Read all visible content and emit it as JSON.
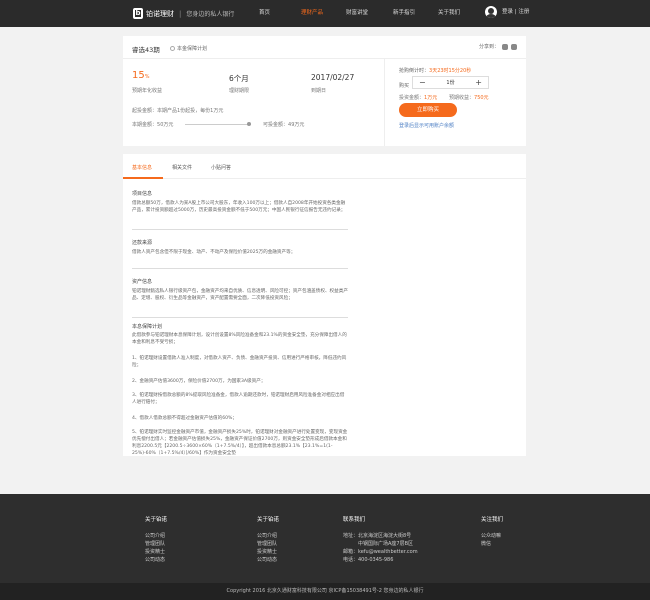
{
  "header": {
    "brand": "铂诺理财",
    "slogan": "您身边的私人银行",
    "nav": [
      "首页",
      "理财产品",
      "财富讲堂",
      "新手指引",
      "关于我们"
    ],
    "login": "登录 | 注册"
  },
  "product": {
    "title": "睿选43期",
    "plan": "本金保障计划",
    "share": "分享到：",
    "rate": "15",
    "rate_unit": "%",
    "rate_label": "预期年化收益",
    "term": "6个月",
    "term_label": "理财期限",
    "date": "2017/02/27",
    "date_label": "到期日",
    "min_note": "起投金额：本期产品1份起投，每份1万元",
    "total_label": "本期金额：",
    "total_value": "50万元",
    "avail_label": "可投金额：",
    "avail_value": "49万元",
    "countdown_prefix": "抢购倒计时：",
    "countdown": "3天23时15分20秒",
    "buy_label": "购买",
    "qty": "1份",
    "min_invest_label": "投资金额：",
    "min_invest": "1万元",
    "expected_label": "预期收益：",
    "expected": "750元",
    "buy_button": "立即购买",
    "tip": "登录后显示可用账户余额"
  },
  "tabs": [
    "基本信息",
    "相关文件",
    "小贴问答"
  ],
  "sections": [
    {
      "h": "项目信息",
      "p": "借款总额50万，借款人为某A股上市公司大股东，年收入100万以上；借款人自2008年开始投资各类金融产品，累计投资额超过5000万，历史最高投资金额不低于500万元；中国人民银行征信报告无违约记录；"
    },
    {
      "h": "还款来源",
      "p": "借款人资产包含但不限于现金、动产、不动产及保险价值2025万的金融资产等；"
    },
    {
      "h": "资产信息",
      "p": "铂诺理财甄选私人银行级资产包，金融资产均来自优质、信息透明、风险可控；资产包涵盖债权、权益类产品、定增、股权、衍生品等金融资产，资产配置需要全面，二次降低投资风险；"
    },
    {
      "h": "本息保障计划",
      "p": "此借款参与铂诺理财本息保障计划，设计创设置8%风险准备金和23.1%的资金安全垫，充分保障出借人的本金和利息不受亏损；"
    },
    {
      "h": "",
      "p": "1、铂诺理财设置借款人准入制度，对借款人资产、负债、金融资产投资、信用进行严格审核，降低违约风险；"
    },
    {
      "h": "",
      "p": "2、金融资产估值3600万，保险价值2700万，为国家3A级资产；"
    },
    {
      "h": "",
      "p": "3、铂诺理财按借款总额的8%提取风险准备金，借款人逾期还款时，铂诺理财启用风险准备金对相应出借人进行赔付；"
    },
    {
      "h": "",
      "p": "4、借款人借款总额不得超过金融资产估值的60%；"
    },
    {
      "h": "",
      "p": "5、铂诺理财实时监控金融资产市值，金融资产损失25%时，铂诺理财对金融资产进行处置变现，变现资金优先偿付出借人；若金融资产估值损失25%，金融资产保证价值2700万，则资金安全垫形成后借款本金和利息2200.5元【2200.5÷3600×60%（1+7.5%/4）】，超出借款本息总额23.1%【23.1%=1(1-25%)-60%（1+7.5%/4）]/60%】作为资金安全垫"
    }
  ],
  "footer": {
    "about_h": "关于铂诺",
    "about": [
      "公司介绍",
      "管理团队",
      "投资精士",
      "公司动态"
    ],
    "about2_h": "关于铂诺",
    "about2": [
      "公司介绍",
      "管理团队",
      "投资精士",
      "公司动态"
    ],
    "contact_h": "联系我们",
    "contact": [
      "地址：北京海淀区海淀大街8号",
      "中钢国际广场A座7层B区",
      "邮箱：kefu@wealthbetter.com",
      "电话：400-0345-986"
    ],
    "follow_h": "关注我们",
    "follow": [
      "公众动嘛",
      "微信"
    ],
    "copyright": "Copyright 2016 北京久通财富科技有限公司 京ICP备15038491号-2 您身边的私人银行"
  }
}
